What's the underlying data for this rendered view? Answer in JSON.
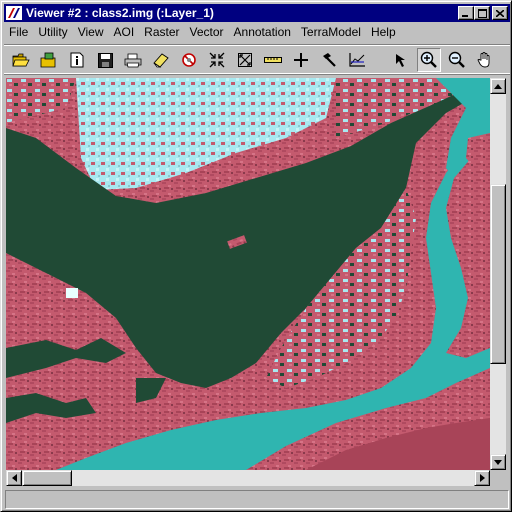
{
  "window": {
    "title": "Viewer #2 : class2.img (:Layer_1)"
  },
  "menu": [
    {
      "label": "File"
    },
    {
      "label": "Utility"
    },
    {
      "label": "View"
    },
    {
      "label": "AOI"
    },
    {
      "label": "Raster"
    },
    {
      "label": "Vector"
    },
    {
      "label": "Annotation"
    },
    {
      "label": "TerraModel"
    },
    {
      "label": "Help"
    }
  ],
  "toolbar": {
    "tools": [
      "open-folder-icon",
      "open-layer-icon",
      "info-icon",
      "save-icon",
      "print-icon",
      "eraser-icon",
      "clear-view-icon",
      "zoom-fit-icon",
      "zoom-full-icon",
      "measure-icon",
      "crosshair-icon",
      "hammer-icon",
      "profile-icon",
      "select-arrow-icon",
      "zoom-in-icon",
      "zoom-out-icon",
      "pan-hand-icon"
    ],
    "active_tool": "zoom-in-icon"
  },
  "status": {
    "text": ""
  },
  "colors": {
    "title_bar": "#000080",
    "dark_water": "#204a35",
    "river": "#2fb5b0",
    "land": "#c45a6e",
    "land_dark": "#8a3a4c",
    "bright": "#a8e8f0"
  }
}
